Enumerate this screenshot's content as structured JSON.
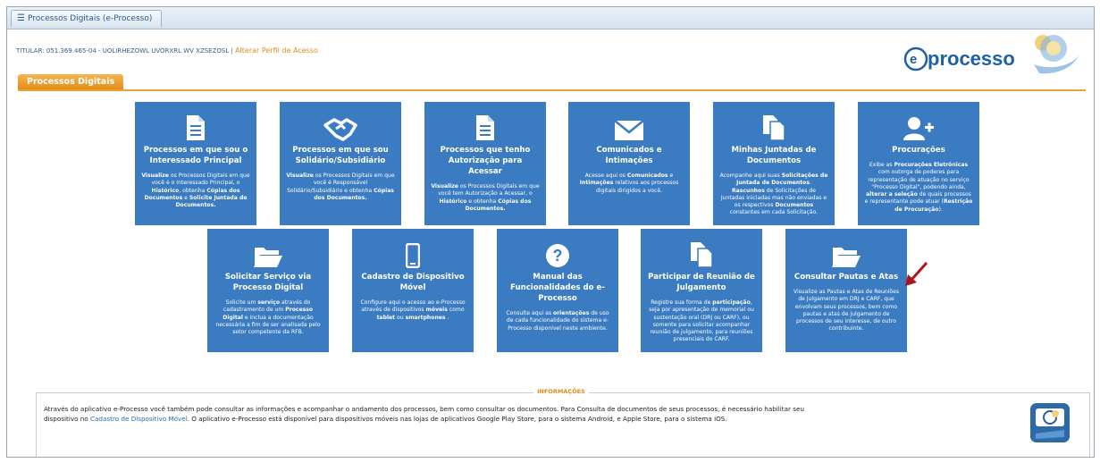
{
  "window": {
    "tab_label": "Processos Digitais (e-Processo)"
  },
  "header": {
    "titular": "TITULAR: 051.369.465-04 - UOLIRHEZOWL UVORXRL WV XZSEZOSL",
    "separator": "|",
    "alter_link": "Alterar Perfil de Acesso",
    "logo_text": "eprocesso"
  },
  "tabs": {
    "main": "Processos Digitais"
  },
  "cards_row1": [
    {
      "title": "Processos em que sou o Interessado Principal",
      "icon": "document-icon",
      "desc": [
        [
          "b",
          "Visualize"
        ],
        [
          "t",
          " os Processos Digitais em que você é o Interessado Principal, o "
        ],
        [
          "b",
          "Histórico"
        ],
        [
          "t",
          ", obtenha "
        ],
        [
          "b",
          "Cópias dos Documentos"
        ],
        [
          "t",
          " e "
        ],
        [
          "b",
          "Solicite Juntada de Documentos."
        ]
      ]
    },
    {
      "title": "Processos em que sou Solidário/Subsidiário",
      "icon": "handshake-icon",
      "desc": [
        [
          "b",
          "Visualize"
        ],
        [
          "t",
          " os Processos Digitais em que você é Responsável Solidário/Subsidiário e obtenha "
        ],
        [
          "b",
          "Cópias dos Documentos."
        ]
      ]
    },
    {
      "title": "Processos que tenho Autorização para Acessar",
      "icon": "document-icon",
      "desc": [
        [
          "b",
          "Visualize"
        ],
        [
          "t",
          " os Processos Digitais em que você tem Autorização a Acessar, o "
        ],
        [
          "b",
          "Histórico"
        ],
        [
          "t",
          " e obtenha "
        ],
        [
          "b",
          "Cópias dos Documentos."
        ]
      ]
    },
    {
      "title": "Comunicados e Intimações",
      "icon": "envelope-icon",
      "desc": [
        [
          "t",
          "Acesse aqui os "
        ],
        [
          "b",
          "Comunicados"
        ],
        [
          "t",
          " e "
        ],
        [
          "b",
          "Intimações"
        ],
        [
          "t",
          " relativos aos processos digitais dirigidos a você."
        ]
      ]
    },
    {
      "title": "Minhas Juntadas de Documentos",
      "icon": "files-icon",
      "desc": [
        [
          "t",
          "Acompanhe aqui suas "
        ],
        [
          "b",
          "Solicitações de Juntada de Documentos"
        ],
        [
          "t",
          ". "
        ],
        [
          "b",
          "Rascunhos"
        ],
        [
          "t",
          " de Solicitações de Juntadas iniciadas mas não enviadas e os respectivos "
        ],
        [
          "b",
          "Documentos"
        ],
        [
          "t",
          " constantes em cada Solicitação."
        ]
      ]
    },
    {
      "title": "Procurações",
      "icon": "user-plus-icon",
      "desc": [
        [
          "t",
          "Exibe as "
        ],
        [
          "b",
          "Procurações Eletrônicas"
        ],
        [
          "t",
          " com outorga de poderes para representação de atuação no serviço \"Processo Digital\", podendo ainda, "
        ],
        [
          "b",
          "alterar a seleção"
        ],
        [
          "t",
          " de quais processos e representante pode atuar ("
        ],
        [
          "b",
          "Restrição de Procuração"
        ],
        [
          "t",
          ")."
        ]
      ]
    }
  ],
  "cards_row2": [
    {
      "title": "Solicitar Serviço via Processo Digital",
      "icon": "folder-open-icon",
      "desc": [
        [
          "t",
          "Solicite um "
        ],
        [
          "b",
          "serviço"
        ],
        [
          "t",
          " através do cadastramento de um "
        ],
        [
          "b",
          "Processo Digital"
        ],
        [
          "t",
          " e inclua a documentação necessária a fim de ser analisada pelo setor competente da RFB."
        ]
      ]
    },
    {
      "title": "Cadastro de Dispositivo Móvel",
      "icon": "mobile-icon",
      "desc": [
        [
          "t",
          "Configure aqui o acesso ao e-Processo através de dispositivos "
        ],
        [
          "b",
          "móveis"
        ],
        [
          "t",
          " como "
        ],
        [
          "b",
          "tablet"
        ],
        [
          "t",
          " ou "
        ],
        [
          "b",
          "smartphones"
        ],
        [
          "t",
          " ."
        ]
      ]
    },
    {
      "title": "Manual das Funcionalidades do e-Processo",
      "icon": "question-icon",
      "desc": [
        [
          "t",
          "Consulte aqui as "
        ],
        [
          "b",
          "orientações"
        ],
        [
          "t",
          " de uso de cada funcionalidade do sistema e-Processo disponível neste ambiente."
        ]
      ]
    },
    {
      "title": "Participar de Reunião de Julgamento",
      "icon": "files-icon",
      "desc": [
        [
          "t",
          "Registre sua forma de "
        ],
        [
          "b",
          "participação"
        ],
        [
          "t",
          ", seja por apresentação de memorial ou sustentação oral (DRJ ou CARF), ou somente para solicitar acompanhar reunião de julgamento, para reuniões presenciais do CARF."
        ]
      ]
    },
    {
      "title": "Consultar Pautas e Atas",
      "icon": "folder-open-icon",
      "desc": [
        [
          "t",
          "Visualize as Pautas e Atas de Reuniões de Julgamento em DRJ e CARF, que envolvam seus processos, bem como pautas e atas de julgamento de processos de seu interesse, de outro contribuinte."
        ]
      ]
    }
  ],
  "info": {
    "legend": "INFORMAÇÕES",
    "line1": "Através do aplicativo e-Processo você também pode consultar as informações e acompanhar o andamento dos processos, bem como consultar os documentos. Para Consulta de documentos de seus processos, é necessário habilitar seu",
    "line2_pre": "dispositivo no ",
    "line2_link": "Cadastro de Dispositivo Móvel",
    "line2_post": ". O aplicativo e-Processo está disponível para dispositivos móveis nas lojas de aplicativos Google Play Store, para o sistema Android, e Apple Store, para o sistema iOS."
  },
  "colors": {
    "card": "#3a7bc2",
    "accent": "#e8a33c",
    "link": "#2b6cb0",
    "arrow": "#b0121b"
  }
}
